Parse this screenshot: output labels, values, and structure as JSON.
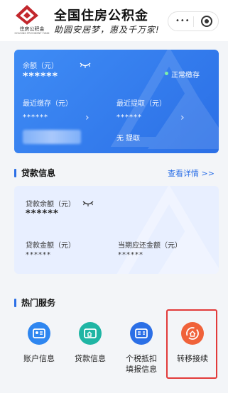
{
  "header": {
    "logo_text": "住房公积金",
    "logo_sub": "HOUSING PROVIDENT FUND",
    "title": "全国住房公积金",
    "slogan": "助圆安居梦，惠及千万家!"
  },
  "account": {
    "balance_label": "余额（元）",
    "balance_value": "******",
    "status": "正常缴存",
    "last_deposit_label": "最近缴存（元）",
    "last_deposit_value": "******",
    "last_withdraw_label": "最近提取（元）",
    "last_withdraw_value": "******",
    "no_withdraw": "无 提取"
  },
  "loan_section": {
    "title": "贷款信息",
    "detail_link": "查看详情 >>",
    "loan_balance_label": "贷款余额（元）",
    "loan_balance_value": "******",
    "loan_amount_label": "贷款金额（元）",
    "loan_amount_value": "******",
    "due_amount_label": "当期应还金额（元）",
    "due_amount_value": "******"
  },
  "services": {
    "title": "热门服务",
    "items": [
      {
        "label": "账户信息",
        "icon": "id-card-icon",
        "color": "#2e86f0"
      },
      {
        "label": "贷款信息",
        "icon": "house-card-icon",
        "color": "#1fb5a4"
      },
      {
        "label": "个税抵扣\n填报信息",
        "icon": "tax-form-icon",
        "color": "#2b6fe6"
      },
      {
        "label": "转移接续",
        "icon": "transfer-house-icon",
        "color": "#f0623a"
      }
    ]
  },
  "colors": {
    "accent": "#2b6fe6",
    "highlight": "#e23a3a"
  }
}
